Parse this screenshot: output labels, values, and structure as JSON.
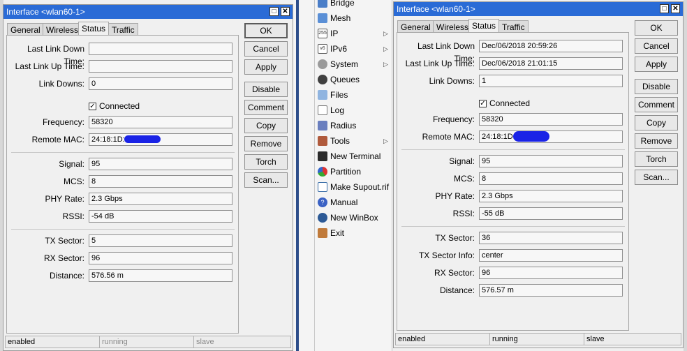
{
  "left_window": {
    "title": "Interface <wlan60-1>",
    "tabs": [
      "General",
      "Wireless",
      "Status",
      "Traffic"
    ],
    "active_tab": "Status",
    "fields": {
      "last_link_down": {
        "label": "Last Link Down Time:",
        "value": ""
      },
      "last_link_up": {
        "label": "Last Link Up Time:",
        "value": ""
      },
      "link_downs": {
        "label": "Link Downs:",
        "value": "0"
      },
      "connected": {
        "label": "Connected",
        "checked": true
      },
      "frequency": {
        "label": "Frequency:",
        "value": "58320"
      },
      "remote_mac": {
        "label": "Remote MAC:",
        "value": "24:18:1D:"
      },
      "signal": {
        "label": "Signal:",
        "value": "95"
      },
      "mcs": {
        "label": "MCS:",
        "value": "8"
      },
      "phy_rate": {
        "label": "PHY Rate:",
        "value": "2.3 Gbps"
      },
      "rssi": {
        "label": "RSSI:",
        "value": "-54 dB"
      },
      "tx_sector": {
        "label": "TX Sector:",
        "value": "5"
      },
      "rx_sector": {
        "label": "RX Sector:",
        "value": "96"
      },
      "distance": {
        "label": "Distance:",
        "value": "576.56 m"
      }
    },
    "buttons": [
      "OK",
      "Cancel",
      "Apply",
      "Disable",
      "Comment",
      "Copy",
      "Remove",
      "Torch",
      "Scan..."
    ],
    "status_bar": [
      "enabled",
      "running",
      "slave"
    ]
  },
  "menu": {
    "items": [
      {
        "label": "Bridge",
        "icon": "bridge-icon",
        "submenu": false
      },
      {
        "label": "Mesh",
        "icon": "mesh-icon",
        "submenu": false
      },
      {
        "label": "IP",
        "icon": "ip-icon",
        "submenu": true
      },
      {
        "label": "IPv6",
        "icon": "ipv6-icon",
        "submenu": true
      },
      {
        "label": "System",
        "icon": "system-icon",
        "submenu": true
      },
      {
        "label": "Queues",
        "icon": "queues-icon",
        "submenu": false
      },
      {
        "label": "Files",
        "icon": "files-icon",
        "submenu": false
      },
      {
        "label": "Log",
        "icon": "log-icon",
        "submenu": false
      },
      {
        "label": "Radius",
        "icon": "radius-icon",
        "submenu": false
      },
      {
        "label": "Tools",
        "icon": "tools-icon",
        "submenu": true
      },
      {
        "label": "New Terminal",
        "icon": "terminal-icon",
        "submenu": false
      },
      {
        "label": "Partition",
        "icon": "partition-icon",
        "submenu": false
      },
      {
        "label": "Make Supout.rif",
        "icon": "supout-icon",
        "submenu": false
      },
      {
        "label": "Manual",
        "icon": "manual-icon",
        "submenu": false
      },
      {
        "label": "New WinBox",
        "icon": "winbox-icon",
        "submenu": false
      },
      {
        "label": "Exit",
        "icon": "exit-icon",
        "submenu": false
      }
    ],
    "icon_glyphs": {
      "ip": "255",
      "ipv6": "v6"
    }
  },
  "right_window": {
    "title": "Interface <wlan60-1>",
    "tabs": [
      "General",
      "Wireless",
      "Status",
      "Traffic"
    ],
    "active_tab": "Status",
    "fields": {
      "last_link_down": {
        "label": "Last Link Down Time:",
        "value": "Dec/06/2018 20:59:26"
      },
      "last_link_up": {
        "label": "Last Link Up Time:",
        "value": "Dec/06/2018 21:01:15"
      },
      "link_downs": {
        "label": "Link Downs:",
        "value": "1"
      },
      "connected": {
        "label": "Connected",
        "checked": true
      },
      "frequency": {
        "label": "Frequency:",
        "value": "58320"
      },
      "remote_mac": {
        "label": "Remote MAC:",
        "value": "24:18:1D:"
      },
      "signal": {
        "label": "Signal:",
        "value": "95"
      },
      "mcs": {
        "label": "MCS:",
        "value": "8"
      },
      "phy_rate": {
        "label": "PHY Rate:",
        "value": "2.3 Gbps"
      },
      "rssi": {
        "label": "RSSI:",
        "value": "-55 dB"
      },
      "tx_sector": {
        "label": "TX Sector:",
        "value": "36"
      },
      "tx_sector_info": {
        "label": "TX Sector Info:",
        "value": "center"
      },
      "rx_sector": {
        "label": "RX Sector:",
        "value": "96"
      },
      "distance": {
        "label": "Distance:",
        "value": "576.57 m"
      }
    },
    "buttons": [
      "OK",
      "Cancel",
      "Apply",
      "Disable",
      "Comment",
      "Copy",
      "Remove",
      "Torch",
      "Scan..."
    ],
    "status_bar": [
      "enabled",
      "running",
      "slave"
    ]
  },
  "colors": {
    "titlebar": "#2a6bd6",
    "redaction": "#1a23e6"
  }
}
